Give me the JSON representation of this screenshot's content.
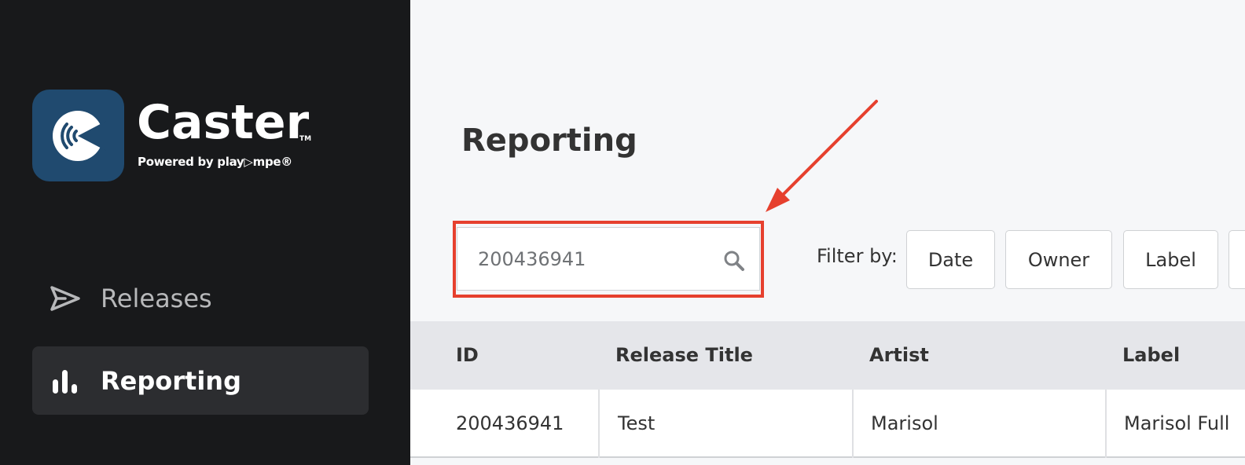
{
  "brand": {
    "name": "Caster",
    "trademark": "TM",
    "tagline": "Powered by play▷mpe®",
    "tile_color": "#204a6f",
    "icon": "caster-logo-icon"
  },
  "sidebar": {
    "items": [
      {
        "label": "Releases",
        "icon": "send-icon",
        "active": false
      },
      {
        "label": "Reporting",
        "icon": "bar-chart-icon",
        "active": true
      }
    ]
  },
  "main": {
    "title": "Reporting",
    "search": {
      "value": "200436941",
      "icon": "search-icon"
    },
    "annotation_color": "#e6402e",
    "filter": {
      "label": "Filter by:",
      "buttons": [
        "Date",
        "Owner",
        "Label"
      ]
    },
    "table": {
      "columns": [
        "ID",
        "Release Title",
        "Artist",
        "Label"
      ],
      "rows": [
        [
          "200436941",
          "Test",
          "Marisol",
          "Marisol Full"
        ]
      ]
    }
  }
}
